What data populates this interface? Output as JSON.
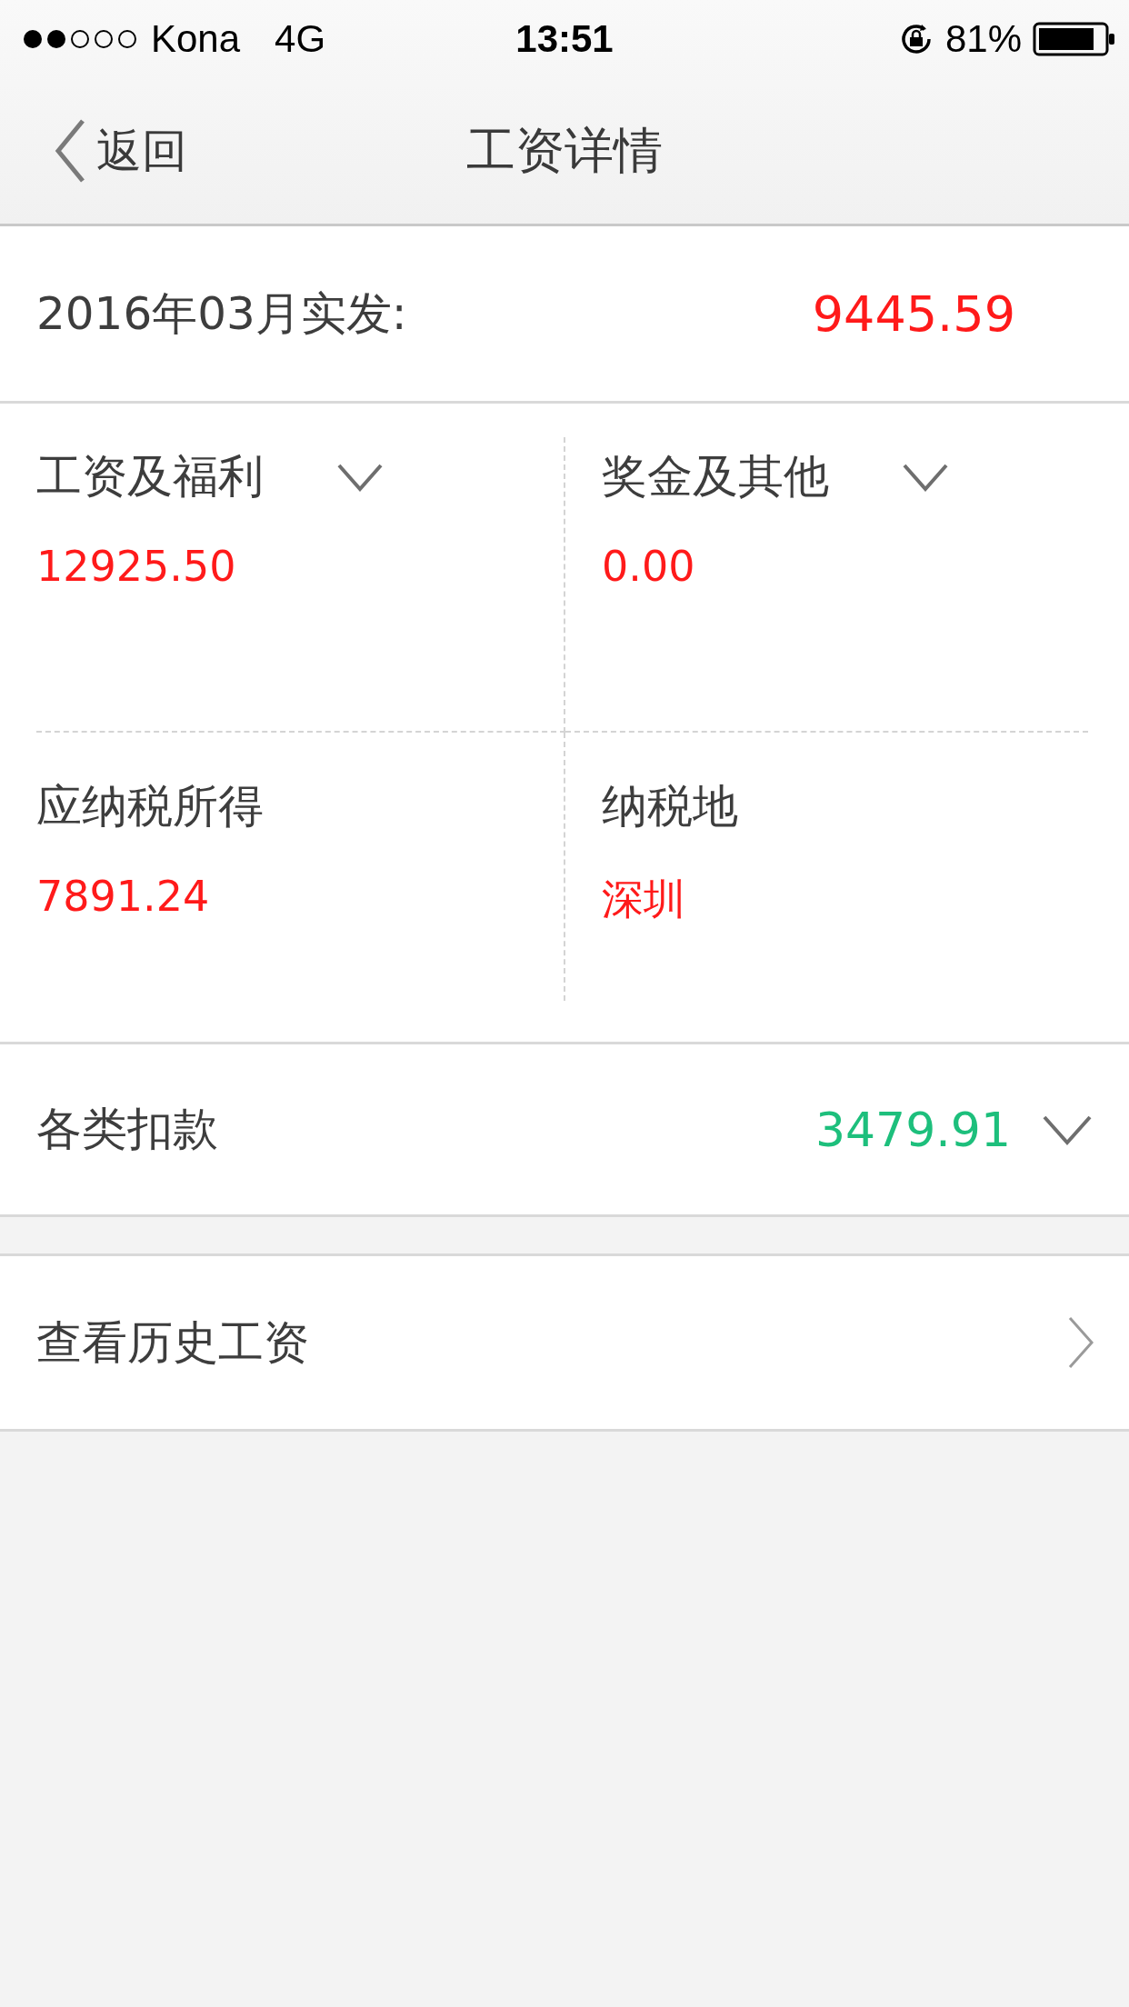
{
  "status_bar": {
    "carrier": "Kona",
    "network": "4G",
    "time": "13:51",
    "battery": "81%"
  },
  "nav": {
    "back": "返回",
    "title": "工资详情"
  },
  "net_pay": {
    "label": "2016年03月实发:",
    "value": "9445.59"
  },
  "items": [
    {
      "label": "工资及福利",
      "value": "12925.50",
      "kind": "expandable"
    },
    {
      "label": "奖金及其他",
      "value": "0.00",
      "kind": "expandable"
    },
    {
      "label": "应纳税所得",
      "value": "7891.24",
      "kind": "plain"
    },
    {
      "label": "纳税地",
      "value": "深圳",
      "kind": "plain"
    }
  ],
  "deductions": {
    "label": "各类扣款",
    "value": "3479.91"
  },
  "history": {
    "label": "查看历史工资"
  }
}
